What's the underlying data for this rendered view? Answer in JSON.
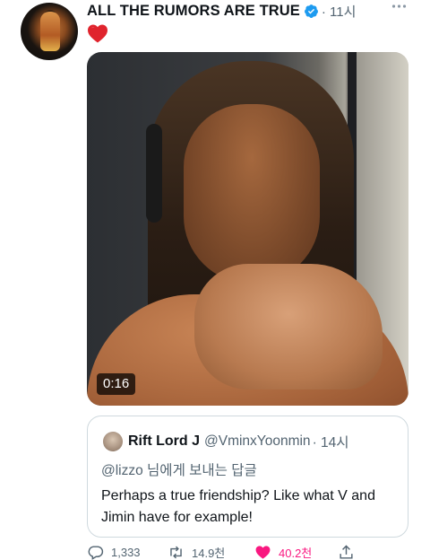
{
  "tweet": {
    "display_name": "ALL THE RUMORS ARE TRUE",
    "separator_time": "· 11시",
    "text_emoji": "❤️",
    "video_duration": "0:16"
  },
  "quote": {
    "display_name": "Rift Lord J",
    "handle": "@VminxYoonmin",
    "time": "· 14시",
    "replying_to": "@lizzo 님에게 보내는 답글",
    "text": "Perhaps a true friendship? Like what V and Jimin have for example!"
  },
  "actions": {
    "reply_count": "1,333",
    "retweet_count": "14.9천",
    "like_count": "40.2천"
  },
  "colors": {
    "verified_blue": "#1d9bf0",
    "like_pink": "#f91880",
    "secondary_text": "#536471"
  },
  "icons": [
    "verified-badge-icon",
    "more-icon",
    "heart-emoji-icon",
    "reply-icon",
    "retweet-icon",
    "like-icon",
    "share-icon"
  ]
}
